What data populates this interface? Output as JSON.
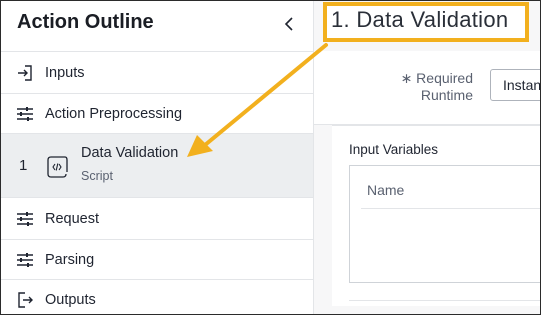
{
  "sidebar": {
    "title": "Action Outline",
    "items": [
      {
        "label": "Inputs",
        "icon": "sign-in-icon"
      },
      {
        "label": "Action Preprocessing",
        "icon": "sliders-icon"
      },
      {
        "number": "1",
        "label": "Data Validation",
        "sublabel": "Script",
        "icon": "script-scroll-icon",
        "active": true
      },
      {
        "label": "Request",
        "icon": "sliders-icon"
      },
      {
        "label": "Parsing",
        "icon": "sliders-icon"
      },
      {
        "label": "Outputs",
        "icon": "sign-out-icon"
      }
    ]
  },
  "main": {
    "title": "1.  Data Validation",
    "required_runtime_label_line1": "∗ Required",
    "required_runtime_label_line2": "Runtime",
    "runtime_value": "Instan",
    "input_variables_label": "Input Variables",
    "table_header_name": "Name"
  },
  "colors": {
    "highlight": "#f2b01e",
    "active_bg": "#eceef0"
  }
}
